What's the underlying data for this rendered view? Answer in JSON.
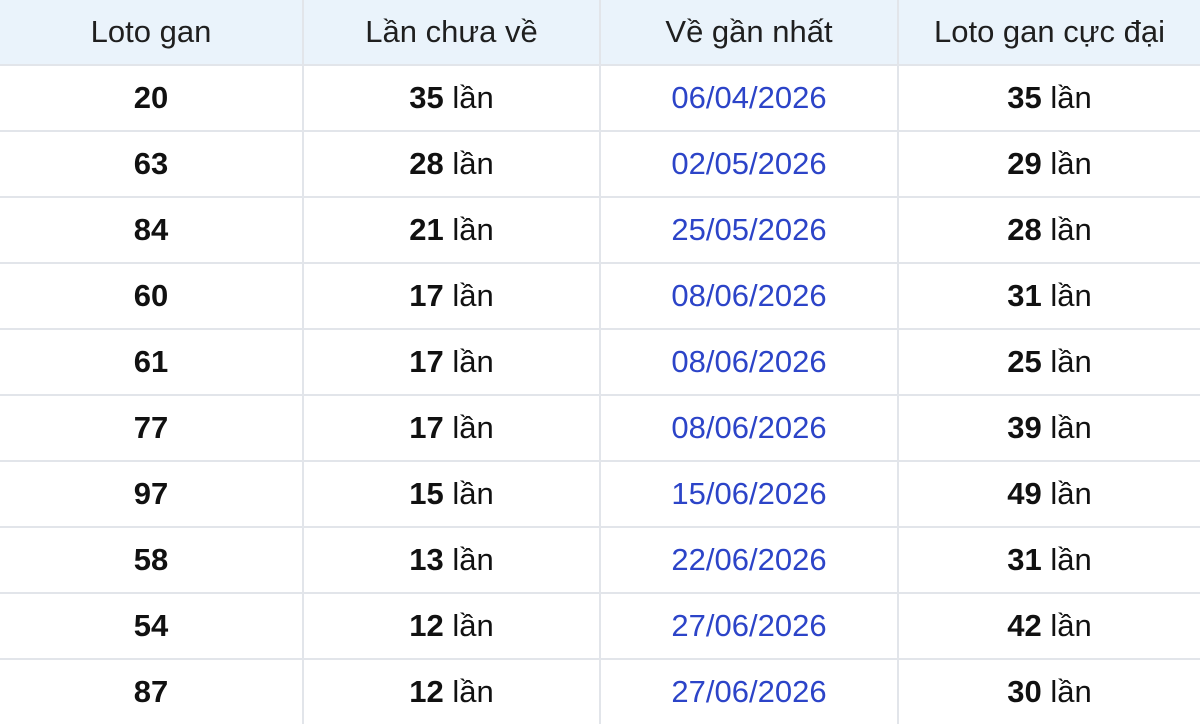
{
  "table": {
    "headers": [
      "Loto gan",
      "Lần chưa về",
      "Về gần nhất",
      "Loto gan cực đại"
    ],
    "unit": "lần",
    "rows": [
      {
        "loto": "20",
        "absent": "35",
        "last": "06/04/2026",
        "max": "35"
      },
      {
        "loto": "63",
        "absent": "28",
        "last": "02/05/2026",
        "max": "29"
      },
      {
        "loto": "84",
        "absent": "21",
        "last": "25/05/2026",
        "max": "28"
      },
      {
        "loto": "60",
        "absent": "17",
        "last": "08/06/2026",
        "max": "31"
      },
      {
        "loto": "61",
        "absent": "17",
        "last": "08/06/2026",
        "max": "25"
      },
      {
        "loto": "77",
        "absent": "17",
        "last": "08/06/2026",
        "max": "39"
      },
      {
        "loto": "97",
        "absent": "15",
        "last": "15/06/2026",
        "max": "49"
      },
      {
        "loto": "58",
        "absent": "13",
        "last": "22/06/2026",
        "max": "31"
      },
      {
        "loto": "54",
        "absent": "12",
        "last": "27/06/2026",
        "max": "42"
      },
      {
        "loto": "87",
        "absent": "12",
        "last": "27/06/2026",
        "max": "30"
      }
    ]
  },
  "colors": {
    "header_bg": "#eaf3fb",
    "date_text": "#2c44c8",
    "grid_line": "#e2e5ea"
  }
}
